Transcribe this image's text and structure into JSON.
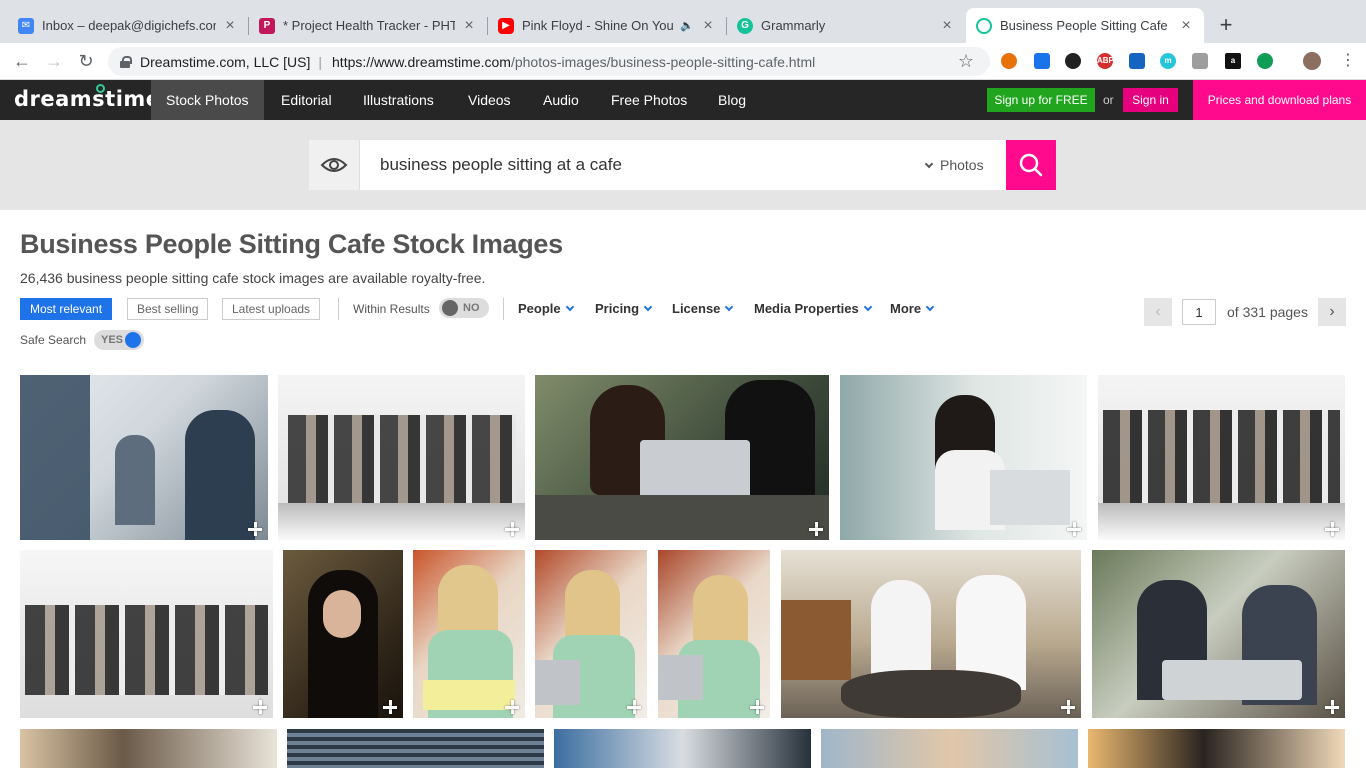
{
  "browser": {
    "tabs": [
      {
        "title": "Inbox – deepak@digichefs.com",
        "icon": "gmail-icon",
        "color": "#4285f4"
      },
      {
        "title": "* Project Health Tracker - PHT",
        "icon": "pht-icon",
        "color": "#c2185b"
      },
      {
        "title": "Pink Floyd - Shine On You C",
        "icon": "youtube-icon",
        "color": "#ff0000"
      },
      {
        "title": "Grammarly",
        "icon": "grammarly-icon",
        "color": "#15c39a"
      },
      {
        "title": "Business People Sitting Cafe S",
        "icon": "dreamstime-icon",
        "color": "#15c39a"
      }
    ],
    "origin": "Dreamstime.com, LLC [US]",
    "url_host": "https://www.dreamstime.com",
    "url_path": "/photos-images/business-people-sitting-cafe.html",
    "ext_badge": "6"
  },
  "site": {
    "logo": "dreamstime.",
    "nav": [
      "Stock Photos",
      "Editorial",
      "Illustrations",
      "Videos",
      "Audio",
      "Free Photos",
      "Blog"
    ],
    "signup": "Sign up for FREE",
    "or": "or",
    "signin": "Sign in",
    "pricing": "Prices and download plans",
    "accent_pink": "#ff0a8c",
    "accent_green": "#21a51f"
  },
  "search": {
    "query": "business people sitting at a cafe",
    "media_type": "Photos"
  },
  "results": {
    "title": "Business People Sitting Cafe Stock Images",
    "subtitle": "26,436 business people sitting cafe stock images are available royalty-free.",
    "sort": [
      "Most relevant",
      "Best selling",
      "Latest uploads"
    ],
    "within_label": "Within Results",
    "within_value": "NO",
    "filters": [
      "People",
      "Pricing",
      "License",
      "Media Properties",
      "More"
    ],
    "page": "1",
    "page_total": "of 331 pages",
    "safe_label": "Safe Search",
    "safe_value": "YES"
  }
}
